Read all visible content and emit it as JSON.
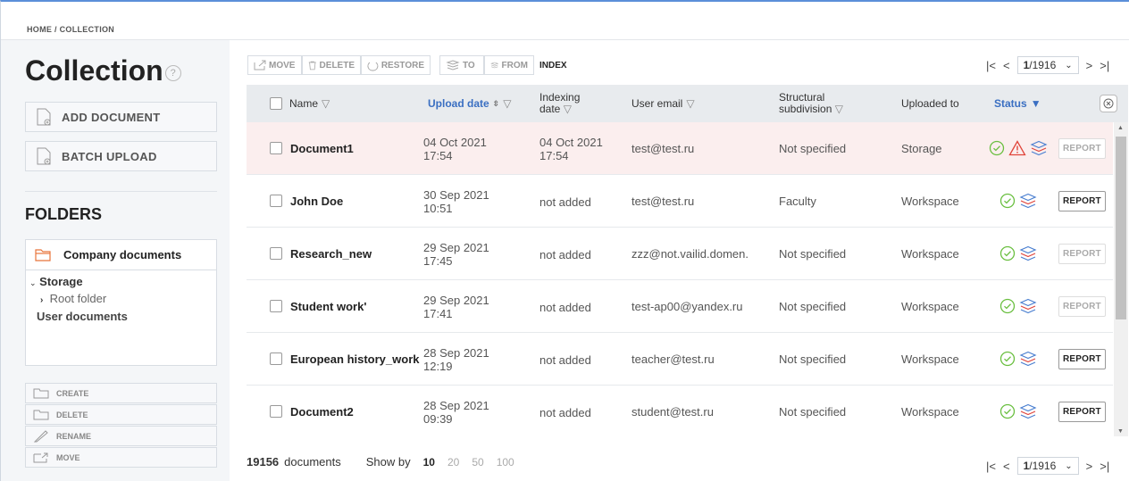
{
  "breadcrumb": "HOME / COLLECTION",
  "page_title": "Collection",
  "help_glyph": "?",
  "sidebar": {
    "add_document": "ADD DOCUMENT",
    "batch_upload": "BATCH UPLOAD",
    "folders_heading": "FOLDERS",
    "selected_folder": "Company documents",
    "tree": {
      "storage": "Storage",
      "root_folder": "Root folder",
      "user_documents": "User documents"
    },
    "folder_actions": [
      "CREATE",
      "DELETE",
      "RENAME",
      "MOVE"
    ]
  },
  "toolbar": {
    "move": "MOVE",
    "delete": "DELETE",
    "restore": "RESTORE",
    "to": "TO",
    "from": "FROM",
    "index": "INDEX"
  },
  "pagination": {
    "current": "1",
    "total": "/1916"
  },
  "table": {
    "columns": {
      "name": "Name",
      "upload_date": "Upload date",
      "indexing_date_1": "Indexing",
      "indexing_date_2": "date",
      "user_email": "User email",
      "subdivision_1": "Structural",
      "subdivision_2": "subdivision",
      "uploaded_to": "Uploaded to",
      "status": "Status"
    },
    "rows": [
      {
        "name": "Document1",
        "upload_date": "04 Oct 2021",
        "upload_time": "17:54",
        "index_date": "04 Oct 2021",
        "index_time": "17:54",
        "email": "test@test.ru",
        "subdivision": "Not specified",
        "uploaded_to": "Storage",
        "report": "REPORT"
      },
      {
        "name": "John Doe",
        "upload_date": "30 Sep 2021",
        "upload_time": "10:51",
        "index_date": "not added",
        "index_time": "",
        "email": "test@test.ru",
        "subdivision": "Faculty",
        "uploaded_to": "Workspace",
        "report": "REPORT"
      },
      {
        "name": "Research_new",
        "upload_date": "29 Sep 2021",
        "upload_time": "17:45",
        "index_date": "not added",
        "index_time": "",
        "email": "zzz@not.vailid.domen.",
        "subdivision": "Not specified",
        "uploaded_to": "Workspace",
        "report": "REPORT"
      },
      {
        "name": "Student work'",
        "upload_date": "29 Sep 2021",
        "upload_time": "17:41",
        "index_date": "not added",
        "index_time": "",
        "email": "test-ap00@yandex.ru",
        "subdivision": "Not specified",
        "uploaded_to": "Workspace",
        "report": "REPORT"
      },
      {
        "name": "European history_work",
        "upload_date": "28 Sep 2021",
        "upload_time": "12:19",
        "index_date": "not added",
        "index_time": "",
        "email": "teacher@test.ru",
        "subdivision": "Not specified",
        "uploaded_to": "Workspace",
        "report": "REPORT"
      },
      {
        "name": "Document2",
        "upload_date": "28 Sep 2021",
        "upload_time": "09:39",
        "index_date": "not added",
        "index_time": "",
        "email": "student@test.ru",
        "subdivision": "Not specified",
        "uploaded_to": "Workspace",
        "report": "REPORT"
      }
    ]
  },
  "footer": {
    "count": "19156",
    "count_label": "documents",
    "show_by": "Show by",
    "sizes": [
      "10",
      "20",
      "50",
      "100"
    ]
  },
  "colors": {
    "accent": "#3a6fc2",
    "ok": "#6abf40",
    "warning": "#e0443a",
    "highlight_row": "#fbeeee",
    "folder": "#e8743b"
  }
}
